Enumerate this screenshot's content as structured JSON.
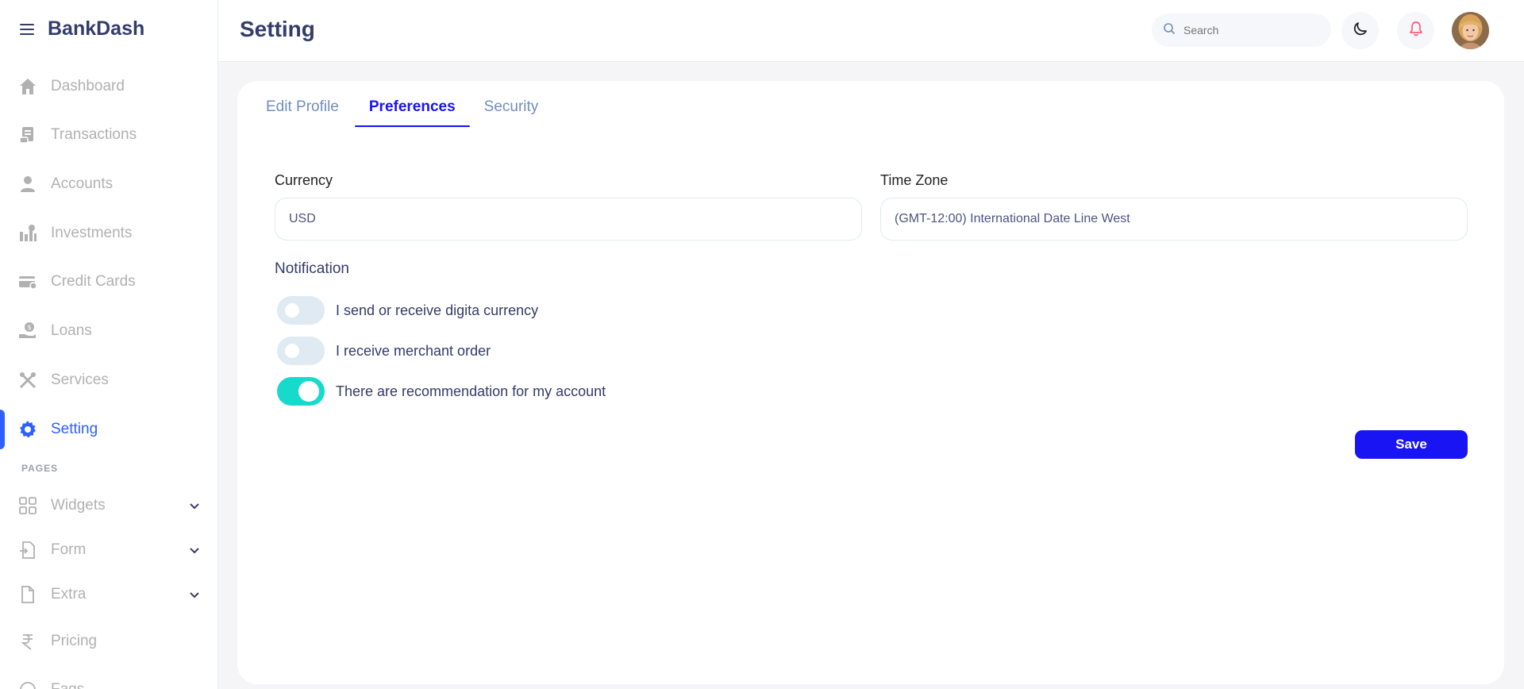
{
  "app": {
    "name": "BankDash"
  },
  "header": {
    "title": "Setting",
    "search_placeholder": "Search"
  },
  "sidebar": {
    "items": [
      {
        "label": "Dashboard",
        "icon": "home-icon"
      },
      {
        "label": "Transactions",
        "icon": "transfer-icon"
      },
      {
        "label": "Accounts",
        "icon": "user-icon"
      },
      {
        "label": "Investments",
        "icon": "investment-icon"
      },
      {
        "label": "Credit Cards",
        "icon": "credit-card-icon"
      },
      {
        "label": "Loans",
        "icon": "loan-icon"
      },
      {
        "label": "Services",
        "icon": "services-icon"
      },
      {
        "label": "Setting",
        "icon": "gear-icon",
        "active": true
      }
    ],
    "pages_label": "PAGES",
    "pages": [
      {
        "label": "Widgets",
        "icon": "grid-icon"
      },
      {
        "label": "Form",
        "icon": "form-icon"
      },
      {
        "label": "Extra",
        "icon": "file-icon"
      },
      {
        "label": "Pricing",
        "icon": "rupee-icon"
      },
      {
        "label": "Faqs",
        "icon": "help-circle-icon"
      }
    ]
  },
  "tabs": [
    {
      "label": "Edit Profile"
    },
    {
      "label": "Preferences",
      "active": true
    },
    {
      "label": "Security"
    }
  ],
  "form": {
    "currency_label": "Currency",
    "currency_value": "USD",
    "timezone_label": "Time Zone",
    "timezone_value": "(GMT-12:00) International Date Line West"
  },
  "notification": {
    "title": "Notification",
    "toggles": [
      {
        "label": "I send or receive digita currency",
        "on": false
      },
      {
        "label": "I receive merchant order",
        "on": false
      },
      {
        "label": "There are recommendation for my account",
        "on": true
      }
    ]
  },
  "save_label": "Save",
  "colors": {
    "primary": "#1814f3",
    "accent": "#2d60ff",
    "toggle_on": "#16dbcc",
    "notification_red": "#fe5c73"
  }
}
